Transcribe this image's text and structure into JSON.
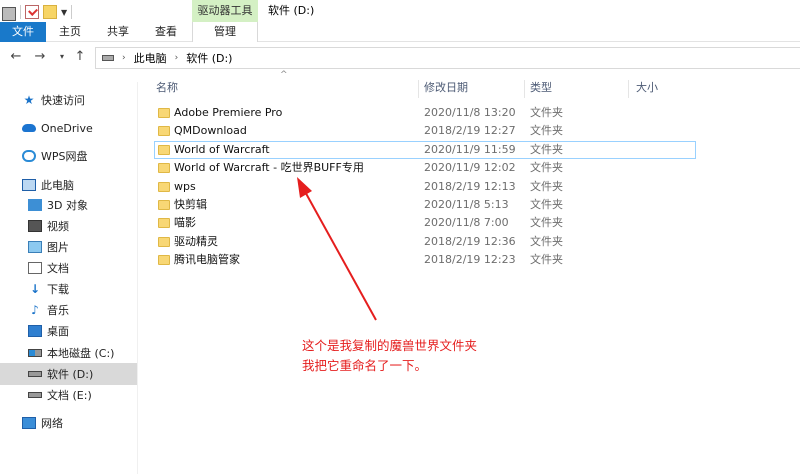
{
  "window": {
    "title": "软件 (D:)",
    "context_group": "驱动器工具"
  },
  "ribbon": {
    "tabs": [
      {
        "label": "文件"
      },
      {
        "label": "主页"
      },
      {
        "label": "共享"
      },
      {
        "label": "查看"
      },
      {
        "label": "管理"
      }
    ]
  },
  "address": {
    "crumbs": [
      "此电脑",
      "软件 (D:)"
    ]
  },
  "nav": {
    "items": [
      {
        "label": "快速访问",
        "icon": "star-icon"
      },
      {
        "label": "OneDrive",
        "icon": "cloud-icon"
      },
      {
        "label": "WPS网盘",
        "icon": "wps-cloud-icon"
      },
      {
        "label": "此电脑",
        "icon": "computer-icon"
      },
      {
        "label": "3D 对象",
        "icon": "cube-icon"
      },
      {
        "label": "视频",
        "icon": "video-icon"
      },
      {
        "label": "图片",
        "icon": "picture-icon"
      },
      {
        "label": "文档",
        "icon": "document-icon"
      },
      {
        "label": "下载",
        "icon": "download-icon"
      },
      {
        "label": "音乐",
        "icon": "music-icon"
      },
      {
        "label": "桌面",
        "icon": "desktop-icon"
      },
      {
        "label": "本地磁盘 (C:)",
        "icon": "system-drive-icon"
      },
      {
        "label": "软件 (D:)",
        "icon": "drive-icon",
        "selected": true
      },
      {
        "label": "文档 (E:)",
        "icon": "drive-icon"
      },
      {
        "label": "网络",
        "icon": "network-icon"
      }
    ]
  },
  "columns": {
    "name": "名称",
    "date": "修改日期",
    "type": "类型",
    "size": "大小"
  },
  "files": [
    {
      "name": "Adobe Premiere Pro",
      "date": "2020/11/8 13:20",
      "type": "文件夹"
    },
    {
      "name": "QMDownload",
      "date": "2018/2/19 12:27",
      "type": "文件夹"
    },
    {
      "name": "World of Warcraft",
      "date": "2020/11/9 11:59",
      "type": "文件夹"
    },
    {
      "name": "World of Warcraft - 吃世界BUFF专用",
      "date": "2020/11/9 12:02",
      "type": "文件夹"
    },
    {
      "name": "wps",
      "date": "2018/2/19 12:13",
      "type": "文件夹"
    },
    {
      "name": "快剪辑",
      "date": "2020/11/8 5:13",
      "type": "文件夹"
    },
    {
      "name": "喵影",
      "date": "2020/11/8 7:00",
      "type": "文件夹"
    },
    {
      "name": "驱动精灵",
      "date": "2018/2/19 12:36",
      "type": "文件夹"
    },
    {
      "name": "腾讯电脑管家",
      "date": "2018/2/19 12:23",
      "type": "文件夹"
    }
  ],
  "annotation": {
    "line1": "这个是我复制的魔兽世界文件夹",
    "line2": "我把它重命名了一下。",
    "color": "#e51e1e"
  }
}
